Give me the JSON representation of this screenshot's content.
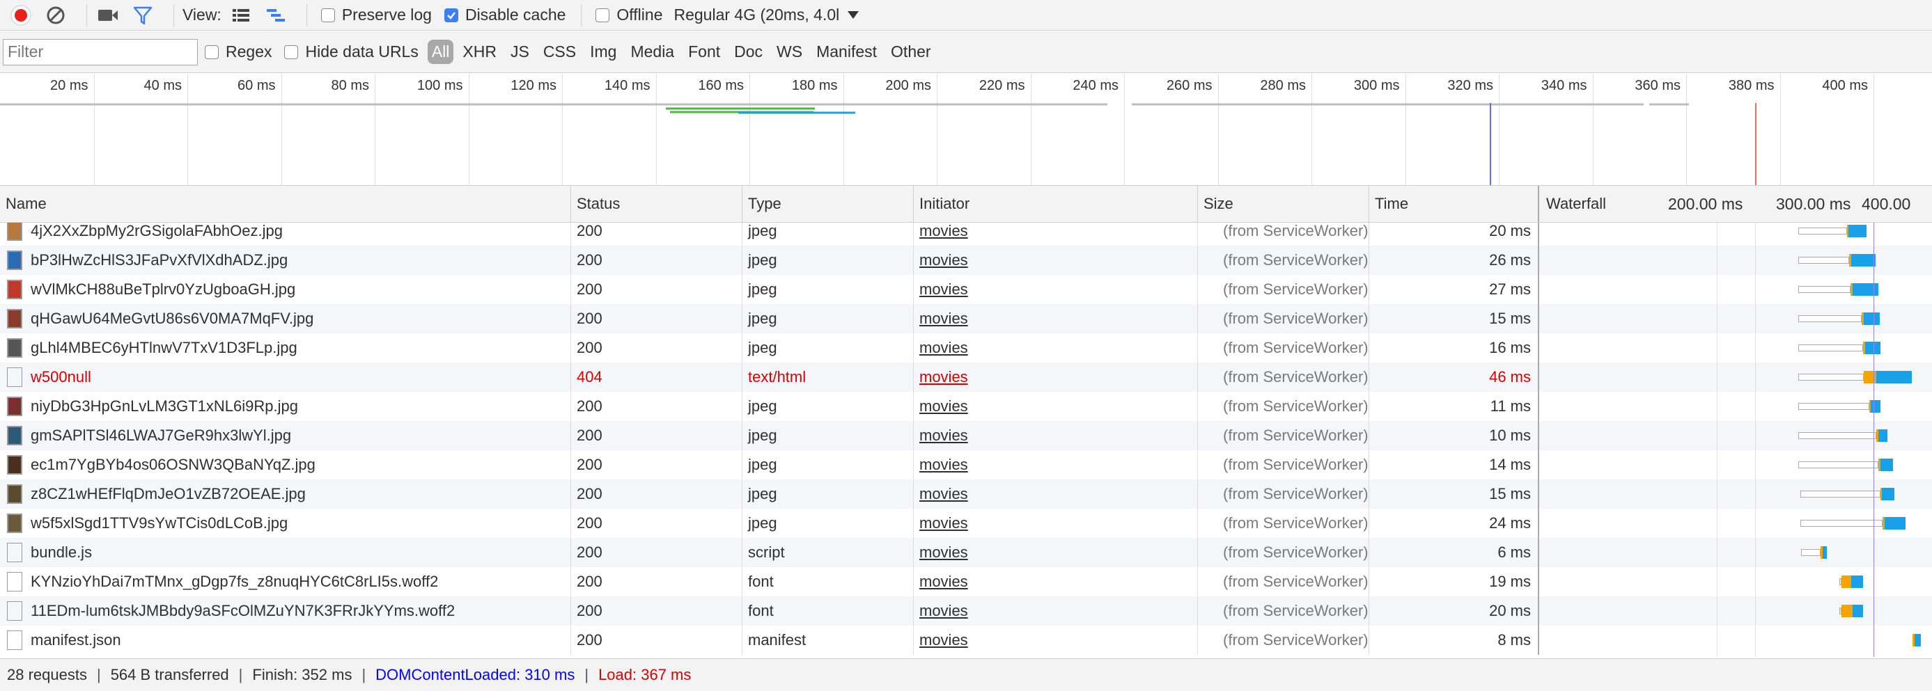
{
  "toolbar": {
    "view_label": "View:",
    "preserve_log": {
      "label": "Preserve log",
      "checked": false
    },
    "disable_cache": {
      "label": "Disable cache",
      "checked": true
    },
    "offline": {
      "label": "Offline",
      "checked": false
    },
    "throttle": "Regular 4G (20ms, 4.0l"
  },
  "filterbar": {
    "placeholder": "Filter",
    "regex_label": "Regex",
    "hide_data_urls_label": "Hide data URLs",
    "types": [
      "All",
      "XHR",
      "JS",
      "CSS",
      "Img",
      "Media",
      "Font",
      "Doc",
      "WS",
      "Manifest",
      "Other"
    ],
    "active_type": "All"
  },
  "overview": {
    "ticks": [
      "20 ms",
      "40 ms",
      "60 ms",
      "80 ms",
      "100 ms",
      "120 ms",
      "140 ms",
      "160 ms",
      "180 ms",
      "200 ms",
      "220 ms",
      "240 ms",
      "260 ms",
      "280 ms",
      "300 ms",
      "320 ms",
      "340 ms",
      "360 ms",
      "380 ms",
      "400 ms",
      "42"
    ]
  },
  "columns": {
    "name": "Name",
    "status": "Status",
    "type": "Type",
    "initiator": "Initiator",
    "size": "Size",
    "time": "Time",
    "waterfall": "Waterfall",
    "wf_ticks": [
      "200.00 ms",
      "300.00 ms",
      "400.00"
    ]
  },
  "requests": [
    {
      "name": "4jX2XxZbpMy2rGSigolaFAbhOez.jpg",
      "status": "200",
      "type": "jpeg",
      "initiator": "movies",
      "size": "(from ServiceWorker)",
      "time": "20 ms"
    },
    {
      "name": "bP3lHwZcHlS3JFaPvXfVlXdhADZ.jpg",
      "status": "200",
      "type": "jpeg",
      "initiator": "movies",
      "size": "(from ServiceWorker)",
      "time": "26 ms"
    },
    {
      "name": "wVlMkCH88uBeTplrv0YzUgboaGH.jpg",
      "status": "200",
      "type": "jpeg",
      "initiator": "movies",
      "size": "(from ServiceWorker)",
      "time": "27 ms"
    },
    {
      "name": "qHGawU64MeGvtU86s6V0MA7MqFV.jpg",
      "status": "200",
      "type": "jpeg",
      "initiator": "movies",
      "size": "(from ServiceWorker)",
      "time": "15 ms"
    },
    {
      "name": "gLhl4MBEC6yHTlnwV7TxV1D3FLp.jpg",
      "status": "200",
      "type": "jpeg",
      "initiator": "movies",
      "size": "(from ServiceWorker)",
      "time": "16 ms"
    },
    {
      "name": "w500null",
      "status": "404",
      "type": "text/html",
      "initiator": "movies",
      "size": "(from ServiceWorker)",
      "time": "46 ms",
      "error": true
    },
    {
      "name": "niyDbG3HpGnLvLM3GT1xNL6i9Rp.jpg",
      "status": "200",
      "type": "jpeg",
      "initiator": "movies",
      "size": "(from ServiceWorker)",
      "time": "11 ms"
    },
    {
      "name": "gmSAPlTSl46LWAJ7GeR9hx3lwYl.jpg",
      "status": "200",
      "type": "jpeg",
      "initiator": "movies",
      "size": "(from ServiceWorker)",
      "time": "10 ms"
    },
    {
      "name": "ec1m7YgBYb4os06OSNW3QBaNYqZ.jpg",
      "status": "200",
      "type": "jpeg",
      "initiator": "movies",
      "size": "(from ServiceWorker)",
      "time": "14 ms"
    },
    {
      "name": "z8CZ1wHEfFlqDmJeO1vZB72OEAE.jpg",
      "status": "200",
      "type": "jpeg",
      "initiator": "movies",
      "size": "(from ServiceWorker)",
      "time": "15 ms"
    },
    {
      "name": "w5f5xlSgd1TTV9sYwTCis0dLCoB.jpg",
      "status": "200",
      "type": "jpeg",
      "initiator": "movies",
      "size": "(from ServiceWorker)",
      "time": "24 ms"
    },
    {
      "name": "bundle.js",
      "status": "200",
      "type": "script",
      "initiator": "movies",
      "size": "(from ServiceWorker)",
      "time": "6 ms"
    },
    {
      "name": "KYNzioYhDai7mTMnx_gDgp7fs_z8nuqHYC6tC8rLI5s.woff2",
      "status": "200",
      "type": "font",
      "initiator": "movies",
      "size": "(from ServiceWorker)",
      "time": "19 ms"
    },
    {
      "name": "11EDm-lum6tskJMBbdy9aSFcOlMZuYN7K3FRrJkYYms.woff2",
      "status": "200",
      "type": "font",
      "initiator": "movies",
      "size": "(from ServiceWorker)",
      "time": "20 ms"
    },
    {
      "name": "manifest.json",
      "status": "200",
      "type": "manifest",
      "initiator": "movies",
      "size": "(from ServiceWorker)",
      "time": "8 ms"
    }
  ],
  "status": {
    "requests": "28 requests",
    "transferred": "564 B transferred",
    "finish": "Finish: 352 ms",
    "dcl": "DOMContentLoaded: 310 ms",
    "load": "Load: 367 ms"
  },
  "colors": {
    "accent": "#3b7ff2",
    "record": "#e8221b",
    "error": "#d40000",
    "dcl": "#0000ff",
    "load": "#d40000",
    "wait": "#f5a300",
    "download": "#1aa0e8"
  }
}
